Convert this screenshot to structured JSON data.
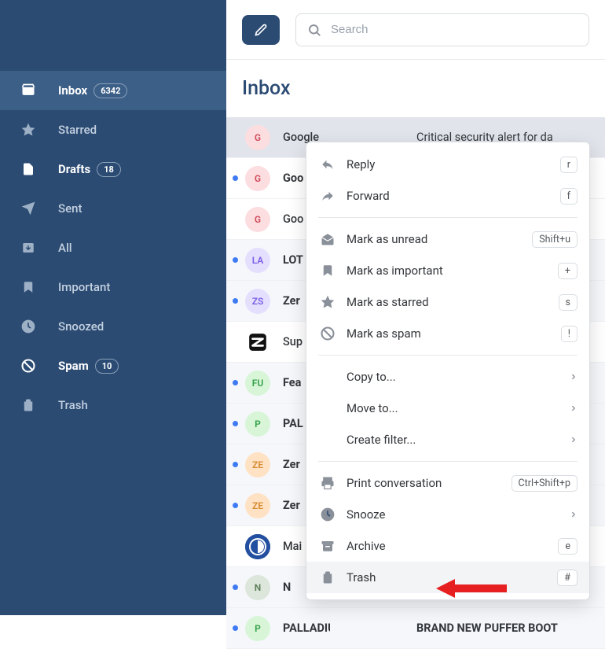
{
  "sidebar": {
    "items": [
      {
        "label": "Inbox",
        "badge": "6342",
        "selected": true,
        "bold": true,
        "icon": "inbox"
      },
      {
        "label": "Starred",
        "icon": "star"
      },
      {
        "label": "Drafts",
        "badge": "18",
        "bold": true,
        "icon": "file"
      },
      {
        "label": "Sent",
        "icon": "send"
      },
      {
        "label": "All",
        "icon": "archive-down"
      },
      {
        "label": "Important",
        "icon": "bookmark"
      },
      {
        "label": "Snoozed",
        "icon": "clock"
      },
      {
        "label": "Spam",
        "badge": "10",
        "bold": true,
        "icon": "ban"
      },
      {
        "label": "Trash",
        "icon": "trash"
      }
    ]
  },
  "header": {
    "search_placeholder": "Search"
  },
  "page_title": "Inbox",
  "emails": [
    {
      "dot": false,
      "avatar": "G",
      "avatar_bg": "#fcdde0",
      "avatar_fg": "#d04a5a",
      "sender": "Google",
      "subject": "Critical security alert for da",
      "selected": true,
      "bold": false,
      "light": false
    },
    {
      "dot": true,
      "avatar": "G",
      "avatar_bg": "#fcdde0",
      "avatar_fg": "#d04a5a",
      "sender": "Goo",
      "subject": "",
      "bold": true,
      "light": true
    },
    {
      "dot": false,
      "avatar": "G",
      "avatar_bg": "#fcdde0",
      "avatar_fg": "#d04a5a",
      "sender": "Goo",
      "subject": "",
      "bold": false,
      "light": true
    },
    {
      "dot": true,
      "avatar": "LA",
      "avatar_bg": "#e4dffd",
      "avatar_fg": "#7a5ee8",
      "sender": "LOT",
      "subject": "",
      "bold": true,
      "light": false
    },
    {
      "dot": true,
      "avatar": "ZS",
      "avatar_bg": "#e4dffd",
      "avatar_fg": "#7a5ee8",
      "sender": "Zer",
      "subject": "",
      "bold": true,
      "light": false
    },
    {
      "dot": false,
      "avatar": "Z",
      "avatar_bg": "#ffffff",
      "avatar_fg": "#111",
      "sender": "Sup",
      "subject": "",
      "bold": false,
      "light": true,
      "zendesk": true
    },
    {
      "dot": true,
      "avatar": "FU",
      "avatar_bg": "#d8f5d8",
      "avatar_fg": "#33a148",
      "sender": "Fea",
      "subject": "",
      "bold": true,
      "light": false
    },
    {
      "dot": true,
      "avatar": "P",
      "avatar_bg": "#d8f5d8",
      "avatar_fg": "#33a148",
      "sender": "PAL",
      "subject": "",
      "bold": true,
      "light": false
    },
    {
      "dot": true,
      "avatar": "ZE",
      "avatar_bg": "#ffe2c4",
      "avatar_fg": "#d68a2e",
      "sender": "Zer",
      "subject": "",
      "bold": true,
      "light": false
    },
    {
      "dot": true,
      "avatar": "ZE",
      "avatar_bg": "#ffe2c4",
      "avatar_fg": "#d68a2e",
      "sender": "Zer",
      "subject": "",
      "bold": true,
      "light": false
    },
    {
      "dot": false,
      "avatar": "M",
      "avatar_bg": "#234fa0",
      "avatar_fg": "#fff",
      "sender": "Mai",
      "subject": "",
      "bold": false,
      "light": true,
      "mailbird": true
    },
    {
      "dot": true,
      "avatar": "N",
      "avatar_bg": "#dce6db",
      "avatar_fg": "#5a7d56",
      "sender": "N",
      "subject": "",
      "bold": true,
      "light": false
    },
    {
      "dot": true,
      "avatar": "P",
      "avatar_bg": "#d8f5d8",
      "avatar_fg": "#33a148",
      "sender": "PALLADIUM",
      "subject": "BRAND NEW PUFFER BOOT",
      "bold": true,
      "light": false
    }
  ],
  "menu": [
    {
      "type": "item",
      "icon": "reply",
      "label": "Reply",
      "shortcut": "r"
    },
    {
      "type": "item",
      "icon": "forward",
      "label": "Forward",
      "shortcut": "f"
    },
    {
      "type": "sep"
    },
    {
      "type": "item",
      "icon": "mail-open",
      "label": "Mark as unread",
      "shortcut": "Shift+u"
    },
    {
      "type": "item",
      "icon": "bookmark",
      "label": "Mark as important",
      "shortcut": "+"
    },
    {
      "type": "item",
      "icon": "star",
      "label": "Mark as starred",
      "shortcut": "s"
    },
    {
      "type": "item",
      "icon": "ban",
      "label": "Mark as spam",
      "shortcut": "!"
    },
    {
      "type": "sep"
    },
    {
      "type": "item",
      "noicon": true,
      "label": "Copy to...",
      "chevron": true
    },
    {
      "type": "item",
      "noicon": true,
      "label": "Move to...",
      "chevron": true
    },
    {
      "type": "item",
      "noicon": true,
      "label": "Create filter...",
      "chevron": true
    },
    {
      "type": "sep"
    },
    {
      "type": "item",
      "icon": "print",
      "label": "Print conversation",
      "shortcut": "Ctrl+Shift+p"
    },
    {
      "type": "item",
      "icon": "clock",
      "label": "Snooze",
      "chevron": true
    },
    {
      "type": "item",
      "icon": "archive",
      "label": "Archive",
      "shortcut": "e"
    },
    {
      "type": "item",
      "icon": "trash",
      "label": "Trash",
      "shortcut": "#",
      "hovered": true
    }
  ],
  "colors": {
    "sidebar_bg": "#2b4b73",
    "accent": "#3f7af5"
  }
}
